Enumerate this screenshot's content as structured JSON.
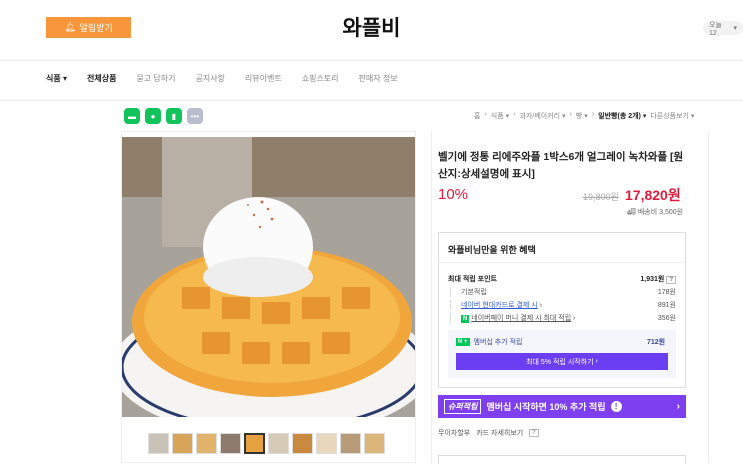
{
  "header": {
    "alarm_button": "알림받기",
    "store_name": "와플비",
    "today_badge": "오늘 12"
  },
  "nav": {
    "items": [
      {
        "label": "식품",
        "has_arrow": true
      },
      {
        "label": "전체상품",
        "bold": true
      },
      {
        "label": "묻고 답하기"
      },
      {
        "label": "공지사항"
      },
      {
        "label": "리뷰이벤트"
      },
      {
        "label": "쇼핑스토리"
      },
      {
        "label": "판매자 정보"
      }
    ]
  },
  "share_icons": [
    "talk-icon",
    "chat-icon",
    "bookmark-icon",
    "more-icon"
  ],
  "breadcrumb": [
    "홈",
    "식품",
    "과자/베이커리",
    "빵",
    "일반빵(총 2개)",
    "다른상품보기"
  ],
  "product": {
    "title": "벨기에 정통 리에주와플 1박스6개 얼그레이 녹차와플 [원산지:상세설명에 표시]",
    "discount": "10%",
    "original_price": "19,800원",
    "sale_price": "17,820원",
    "shipping": "배송비 3,500원"
  },
  "benefits": {
    "title": "와플비님만을 위한 혜택",
    "max_points_label": "최대 적립 포인트",
    "max_points_value": "1,931원",
    "rows": [
      {
        "label": "기본적립",
        "value": "178원"
      },
      {
        "label": "네이버 현대카드로 결제 시",
        "value": "891원"
      },
      {
        "label": "네이버페이 머니 결제 시 최대 적립",
        "value": "356원"
      }
    ],
    "membership_label": "멤버십 추가 적립",
    "membership_badge": "N +",
    "membership_value": "712원",
    "membership_button": "최대 5% 적립 시작하기"
  },
  "banner": {
    "tag": "슈퍼적립",
    "text": "멤버십 시작하면 10% 추가 적립"
  },
  "installment": {
    "label1": "무이자할부",
    "label2": "카드 자세히보기",
    "q": "?"
  },
  "colors": {
    "accent_orange": "#f7963b",
    "price_red": "#e01b3c",
    "purple": "#7d3ff0",
    "naver_green": "#03c75a"
  }
}
